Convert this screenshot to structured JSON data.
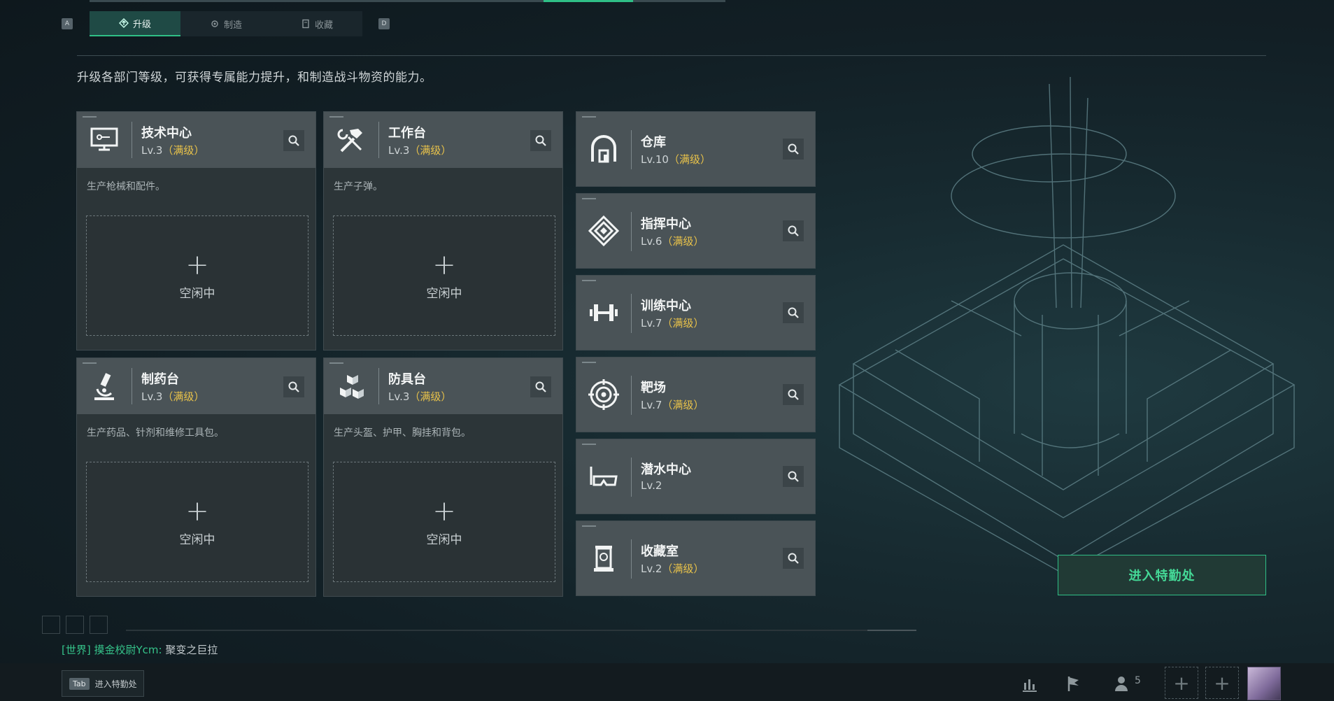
{
  "header": {
    "key_left": "A",
    "key_right": "D",
    "tabs": [
      {
        "label": "升级",
        "active": true
      },
      {
        "label": "制造",
        "active": false
      },
      {
        "label": "收藏",
        "active": false
      }
    ]
  },
  "description": "升级各部门等级，可获得专属能力提升，和制造战斗物资的能力。",
  "workshops": [
    {
      "title": "技术中心",
      "level": "Lv.3",
      "max": "（满级）",
      "desc": "生产枪械和配件。",
      "slot_label": "空闲中",
      "icon": "computer-icon"
    },
    {
      "title": "工作台",
      "level": "Lv.3",
      "max": "（满级）",
      "desc": "生产子弹。",
      "slot_label": "空闲中",
      "icon": "tools-icon"
    },
    {
      "title": "制药台",
      "level": "Lv.3",
      "max": "（满级）",
      "desc": "生产药品、针剂和维修工具包。",
      "slot_label": "空闲中",
      "icon": "microscope-icon"
    },
    {
      "title": "防具台",
      "level": "Lv.3",
      "max": "（满级）",
      "desc": "生产头盔、护甲、胸挂和背包。",
      "slot_label": "空闲中",
      "icon": "armor-icon"
    }
  ],
  "facilities": [
    {
      "title": "仓库",
      "level": "Lv.10",
      "max": "（满级）",
      "icon": "warehouse-icon"
    },
    {
      "title": "指挥中心",
      "level": "Lv.6",
      "max": "（满级）",
      "icon": "command-icon"
    },
    {
      "title": "训练中心",
      "level": "Lv.7",
      "max": "（满级）",
      "icon": "dumbbell-icon"
    },
    {
      "title": "靶场",
      "level": "Lv.7",
      "max": "（满级）",
      "icon": "target-icon"
    },
    {
      "title": "潜水中心",
      "level": "Lv.2",
      "max": "",
      "icon": "goggles-icon"
    },
    {
      "title": "收藏室",
      "level": "Lv.2",
      "max": "（满级）",
      "icon": "display-case-icon"
    }
  ],
  "enter_button": "进入特勤处",
  "chat": {
    "channel": "[世界]",
    "user": "摸金校尉Ycm:",
    "message": "聚变之巨拉"
  },
  "bottom": {
    "tab_key": "Tab",
    "tab_label": "进入特勤处",
    "friends_count": "5"
  },
  "colors": {
    "accent": "#2fbf86",
    "max_level": "#e8c24a",
    "card_head": "#4a5357"
  }
}
